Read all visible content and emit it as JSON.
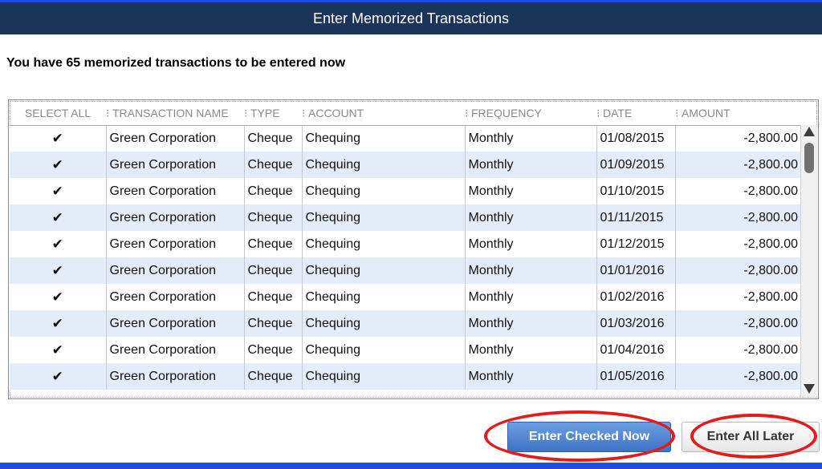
{
  "window": {
    "title": "Enter Memorized Transactions"
  },
  "heading": "You have 65 memorized transactions to be entered now",
  "table": {
    "columns": [
      "SELECT ALL",
      "TRANSACTION NAME",
      "TYPE",
      "ACCOUNT",
      "FREQUENCY",
      "DATE",
      "AMOUNT"
    ],
    "rows": [
      {
        "check": "✔",
        "name": "Green Corporation",
        "type": "Cheque",
        "account": "Chequing",
        "frequency": "Monthly",
        "date": "01/08/2015",
        "amount": "-2,800.00"
      },
      {
        "check": "✔",
        "name": "Green Corporation",
        "type": "Cheque",
        "account": "Chequing",
        "frequency": "Monthly",
        "date": "01/09/2015",
        "amount": "-2,800.00"
      },
      {
        "check": "✔",
        "name": "Green Corporation",
        "type": "Cheque",
        "account": "Chequing",
        "frequency": "Monthly",
        "date": "01/10/2015",
        "amount": "-2,800.00"
      },
      {
        "check": "✔",
        "name": "Green Corporation",
        "type": "Cheque",
        "account": "Chequing",
        "frequency": "Monthly",
        "date": "01/11/2015",
        "amount": "-2,800.00"
      },
      {
        "check": "✔",
        "name": "Green Corporation",
        "type": "Cheque",
        "account": "Chequing",
        "frequency": "Monthly",
        "date": "01/12/2015",
        "amount": "-2,800.00"
      },
      {
        "check": "✔",
        "name": "Green Corporation",
        "type": "Cheque",
        "account": "Chequing",
        "frequency": "Monthly",
        "date": "01/01/2016",
        "amount": "-2,800.00"
      },
      {
        "check": "✔",
        "name": "Green Corporation",
        "type": "Cheque",
        "account": "Chequing",
        "frequency": "Monthly",
        "date": "01/02/2016",
        "amount": "-2,800.00"
      },
      {
        "check": "✔",
        "name": "Green Corporation",
        "type": "Cheque",
        "account": "Chequing",
        "frequency": "Monthly",
        "date": "01/03/2016",
        "amount": "-2,800.00"
      },
      {
        "check": "✔",
        "name": "Green Corporation",
        "type": "Cheque",
        "account": "Chequing",
        "frequency": "Monthly",
        "date": "01/04/2016",
        "amount": "-2,800.00"
      },
      {
        "check": "✔",
        "name": "Green Corporation",
        "type": "Cheque",
        "account": "Chequing",
        "frequency": "Monthly",
        "date": "01/05/2016",
        "amount": "-2,800.00"
      }
    ]
  },
  "buttons": {
    "enter_checked": "Enter Checked Now",
    "enter_later": "Enter All Later"
  },
  "icons": {
    "checkmark": "check-icon",
    "scroll_up": "arrow-up-icon",
    "scroll_down": "arrow-down-icon"
  },
  "colors": {
    "title_bar": "#1b3558",
    "row_alt": "#e3edf9",
    "primary_button": "#3e72c4",
    "highlight_ring": "#e21b1b"
  }
}
